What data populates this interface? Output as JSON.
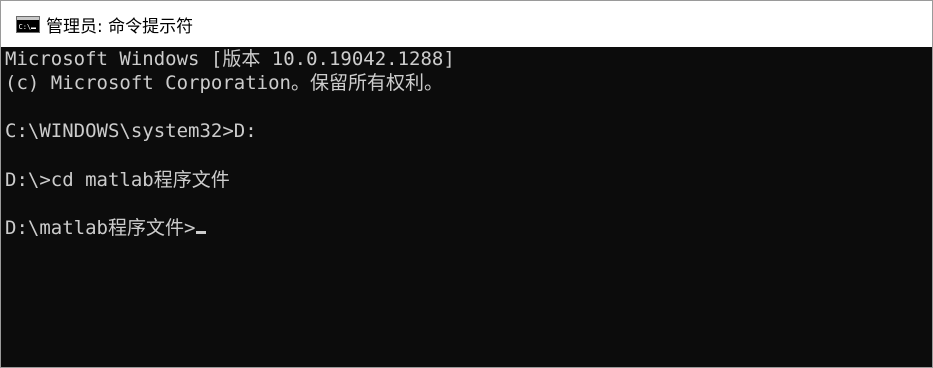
{
  "window": {
    "title": "管理员: 命令提示符",
    "icon": "cmd-console-icon"
  },
  "console": {
    "lines": [
      "Microsoft Windows [版本 10.0.19042.1288]",
      "(c) Microsoft Corporation。保留所有权利。",
      "",
      "C:\\WINDOWS\\system32>D:",
      "",
      "D:\\>cd matlab程序文件",
      "",
      "D:\\matlab程序文件>"
    ]
  },
  "colors": {
    "console_background": "#0c0c0c",
    "console_text": "#cccccc",
    "titlebar_background": "#ffffff"
  }
}
